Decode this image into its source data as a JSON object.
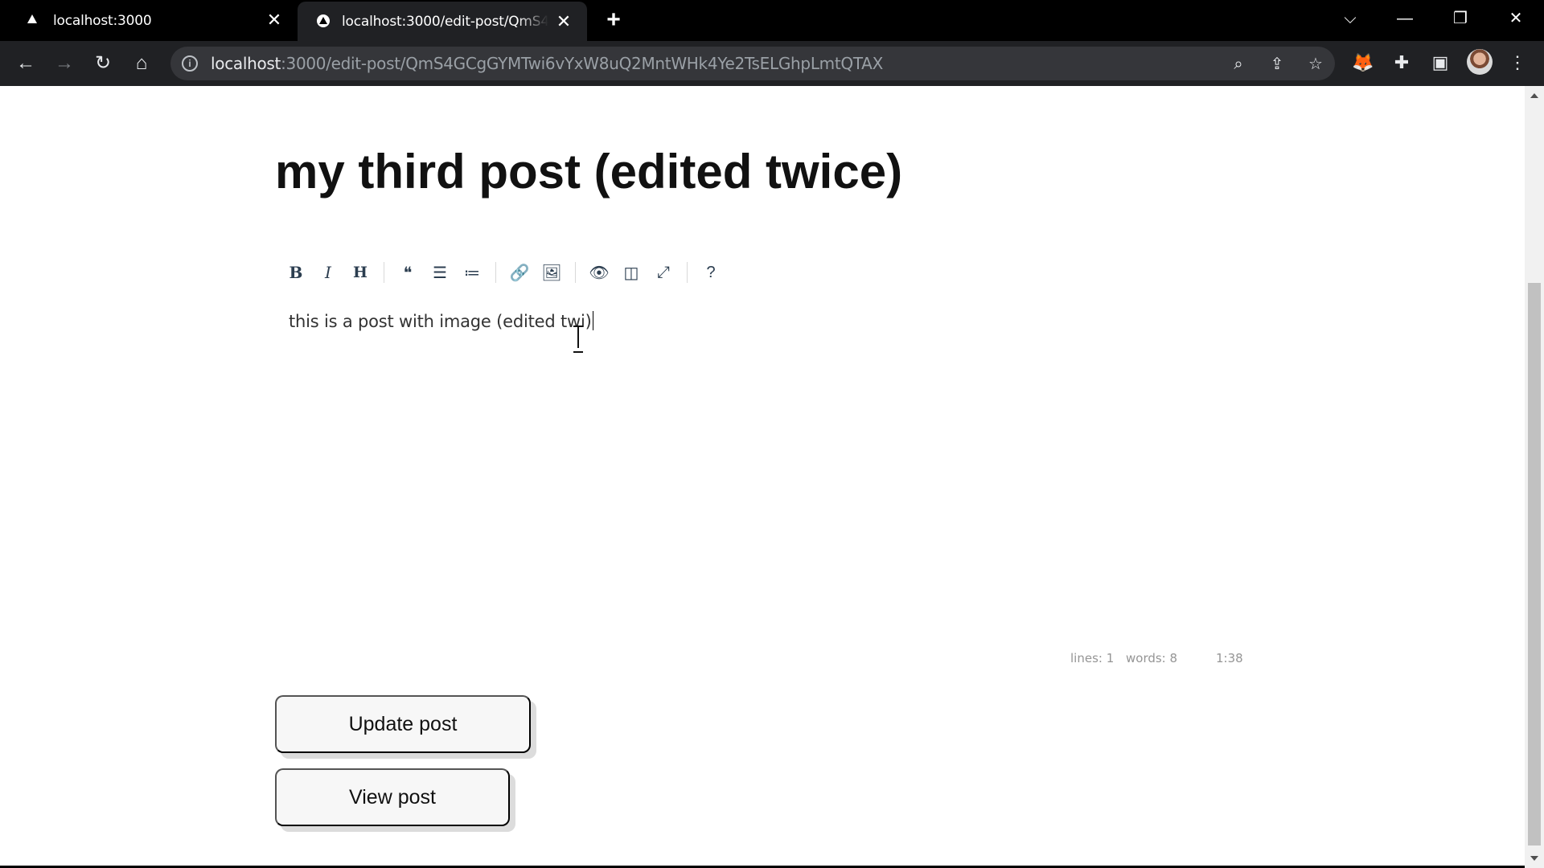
{
  "browser": {
    "tabs": [
      {
        "title": "localhost:3000",
        "active": false
      },
      {
        "title": "localhost:3000/edit-post/QmS4GCgGYMTwi6vYxW8uQ2MntWHk4Ye2TsELGhpLmtQTAX",
        "active": true
      }
    ],
    "url_host": "localhost",
    "url_rest": ":3000/edit-post/QmS4GCgGYMTwi6vYxW8uQ2MntWHk4Ye2TsELGhpLmtQTAX",
    "icons": {
      "back": "arrow-left-icon",
      "forward": "arrow-right-icon",
      "reload": "reload-icon",
      "home": "home-icon",
      "zoom": "zoom-icon",
      "share": "share-icon",
      "bookmark": "star-icon",
      "metamask": "fox-extension-icon",
      "extensions": "puzzle-icon",
      "sidepanel": "side-panel-icon",
      "menu": "kebab-menu-icon"
    }
  },
  "post": {
    "title": "my third post (edited twice)",
    "body": "this is a post with image (edited twi)"
  },
  "editor_toolbar": [
    {
      "name": "bold-button",
      "glyph": "B",
      "cls": "b"
    },
    {
      "name": "italic-button",
      "glyph": "I",
      "cls": "i"
    },
    {
      "name": "heading-button",
      "glyph": "H",
      "cls": "h"
    },
    {
      "sep": true
    },
    {
      "name": "quote-button",
      "glyph": "❝",
      "cls": ""
    },
    {
      "name": "unordered-list-button",
      "glyph": "☰",
      "cls": ""
    },
    {
      "name": "ordered-list-button",
      "glyph": "≔",
      "cls": ""
    },
    {
      "sep": true
    },
    {
      "name": "link-button",
      "glyph": "🔗",
      "cls": ""
    },
    {
      "name": "image-button",
      "glyph": "🖼",
      "cls": ""
    },
    {
      "sep": true
    },
    {
      "name": "preview-button",
      "glyph": "👁",
      "cls": ""
    },
    {
      "name": "side-by-side-button",
      "glyph": "◫",
      "cls": ""
    },
    {
      "name": "fullscreen-button",
      "glyph": "⤢",
      "cls": ""
    },
    {
      "sep": true
    },
    {
      "name": "guide-button",
      "glyph": "?",
      "cls": ""
    }
  ],
  "status": {
    "lines": "lines: 1",
    "words": "words: 8",
    "cursor": "1:38"
  },
  "buttons": {
    "update": "Update post",
    "view": "View post"
  }
}
